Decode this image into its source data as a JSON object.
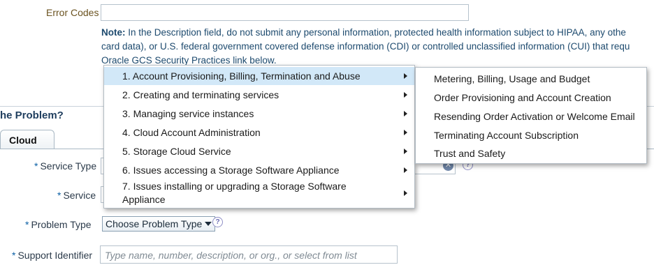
{
  "error_codes": {
    "label": "Error Codes",
    "value": ""
  },
  "note": {
    "bold": "Note:",
    "line1": " In the Description field, do not submit any personal information, protected health information subject to HIPAA, any othe",
    "line2": "card data), or U.S. federal government covered defense information (CDI) or controlled unclassified information (CUI) that requ",
    "line3": "Oracle GCS Security Practices link below."
  },
  "section": {
    "title": "he Problem?"
  },
  "tabs": [
    {
      "label": "Cloud"
    }
  ],
  "form": {
    "service_type_label": "Service Type",
    "service_label": "Service",
    "problem_type_label": "Problem Type",
    "problem_type_value": "Choose Problem Type",
    "support_identifier_label": "Support Identifier",
    "support_identifier_placeholder": "Type name, number, description, or org., or select from list",
    "required_marker": "*",
    "help_glyph": "?"
  },
  "menu": {
    "items": [
      {
        "label": "1. Account Provisioning, Billing, Termination and Abuse",
        "selected": true
      },
      {
        "label": "2. Creating and terminating services"
      },
      {
        "label": "3. Managing service instances"
      },
      {
        "label": "4. Cloud Account Administration"
      },
      {
        "label": "5. Storage Cloud Service"
      },
      {
        "label": "6. Issues accessing a Storage Software Appliance"
      },
      {
        "label_line1": "7. Issues installing or upgrading a Storage Software",
        "label_line2": "Appliance"
      }
    ]
  },
  "submenu": {
    "items": [
      {
        "label": "Metering, Billing, Usage and Budget"
      },
      {
        "label": "Order Provisioning and Account Creation"
      },
      {
        "label": "Resending Order Activation or Welcome Email"
      },
      {
        "label": "Terminating Account Subscription"
      },
      {
        "label": "Trust and Safety"
      }
    ]
  },
  "colors": {
    "menu_highlight": "#d2e8f8",
    "label_brown": "#6b5320",
    "required_blue": "#0b5fa5",
    "note_text": "#1d4a6e"
  }
}
